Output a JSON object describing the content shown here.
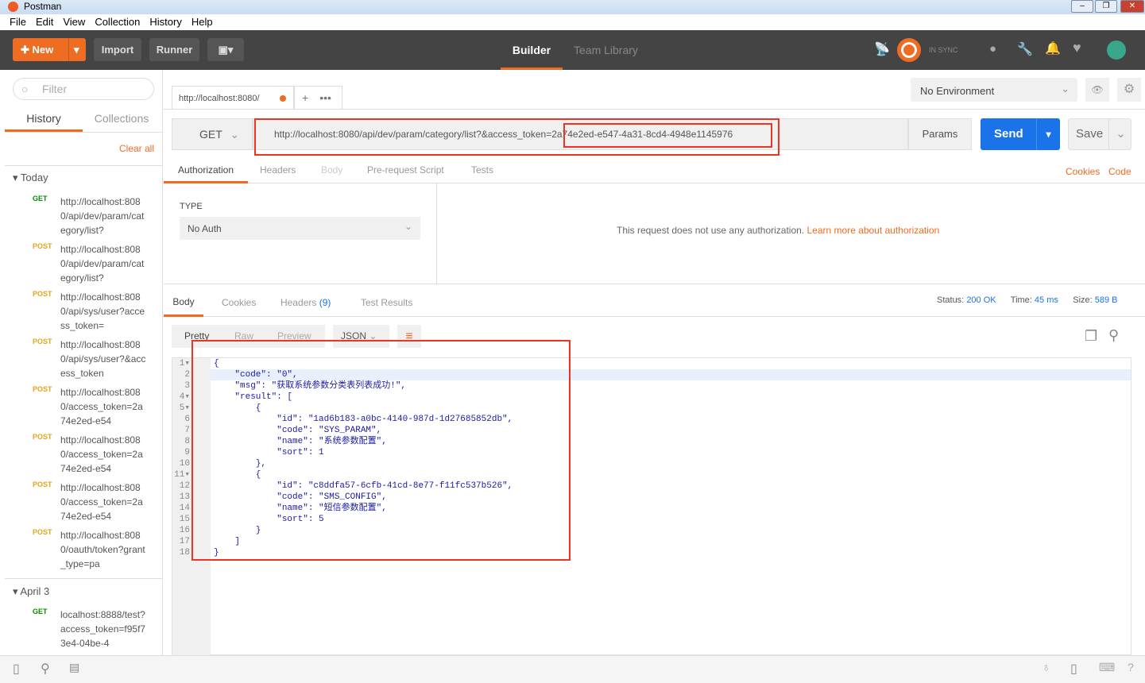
{
  "window": {
    "title": "Postman"
  },
  "menu": [
    "File",
    "Edit",
    "View",
    "Collection",
    "History",
    "Help"
  ],
  "toolbar": {
    "new": "New",
    "import": "Import",
    "runner": "Runner",
    "builder": "Builder",
    "team_library": "Team Library",
    "sync": "IN SYNC"
  },
  "sidebar": {
    "filter_placeholder": "Filter",
    "tabs": [
      "History",
      "Collections"
    ],
    "clear_all": "Clear all",
    "today": "Today",
    "april": "April 3",
    "items": [
      {
        "method": "GET",
        "url": "http://localhost:8080/api/dev/param/category/list?"
      },
      {
        "method": "POST",
        "url": "http://localhost:8080/api/dev/param/category/list?"
      },
      {
        "method": "POST",
        "url": "http://localhost:8080/api/sys/user?access_token="
      },
      {
        "method": "POST",
        "url": "http://localhost:8080/api/sys/user?&access_token"
      },
      {
        "method": "POST",
        "url": "http://localhost:8080/access_token=2a74e2ed-e54"
      },
      {
        "method": "POST",
        "url": "http://localhost:8080/access_token=2a74e2ed-e54"
      },
      {
        "method": "POST",
        "url": "http://localhost:8080/access_token=2a74e2ed-e54"
      },
      {
        "method": "POST",
        "url": "http://localhost:8080/oauth/token?grant_type=pa"
      }
    ],
    "april_items": [
      {
        "method": "GET",
        "url": "localhost:8888/test?access_token=f95f73e4-04be-4"
      }
    ]
  },
  "request": {
    "tab_label": "http://localhost:8080/",
    "method": "GET",
    "url": "http://localhost:8080/api/dev/param/category/list?&access_token=2a74e2ed-e547-4a31-8cd4-4948e1145976",
    "params": "Params",
    "send": "Send",
    "save": "Save",
    "environment": "No Environment",
    "tabs": [
      "Authorization",
      "Headers",
      "Body",
      "Pre-request Script",
      "Tests"
    ],
    "cookies": "Cookies",
    "code": "Code",
    "auth_type_label": "TYPE",
    "auth_type": "No Auth",
    "auth_msg": "This request does not use any authorization.",
    "auth_link": "Learn more about authorization"
  },
  "response": {
    "tabs": [
      "Body",
      "Cookies",
      "Headers",
      "Test Results"
    ],
    "headers_count": "(9)",
    "status_label": "Status:",
    "status": "200 OK",
    "time_label": "Time:",
    "time": "45 ms",
    "size_label": "Size:",
    "size": "589 B",
    "views": [
      "Pretty",
      "Raw",
      "Preview"
    ],
    "format": "JSON",
    "lines": [
      "{",
      "    \"code\": \"0\",",
      "    \"msg\": \"获取系统参数分类表列表成功!\",",
      "    \"result\": [",
      "        {",
      "            \"id\": \"1ad6b183-a0bc-4140-987d-1d27685852db\",",
      "            \"code\": \"SYS_PARAM\",",
      "            \"name\": \"系统参数配置\",",
      "            \"sort\": 1",
      "        },",
      "        {",
      "            \"id\": \"c8ddfa57-6cfb-41cd-8e77-f11fc537b526\",",
      "            \"code\": \"SMS_CONFIG\",",
      "            \"name\": \"短信参数配置\",",
      "            \"sort\": 5",
      "        }",
      "    ]",
      "}"
    ]
  },
  "colors": {
    "accent": "#ef6c23",
    "send": "#1a73e8",
    "toolbar": "#444444"
  }
}
